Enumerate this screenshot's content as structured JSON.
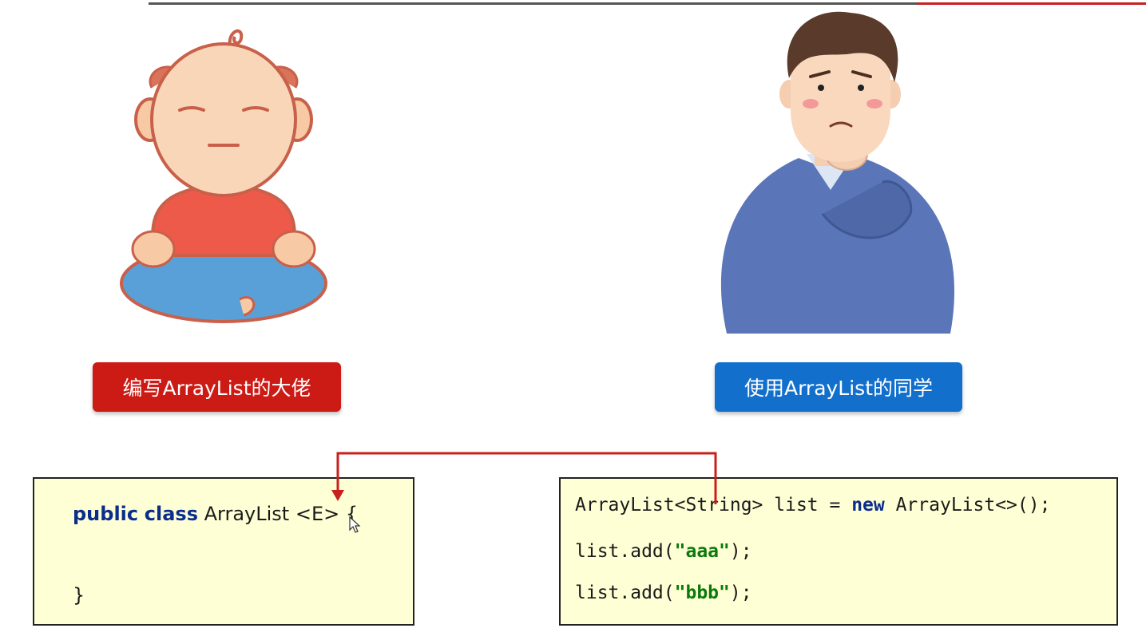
{
  "labels": {
    "left": "编写ArrayList的大佬",
    "right": "使用ArrayList的同学"
  },
  "code_left": {
    "line1_kw1": "public",
    "line1_kw2": "class",
    "line1_rest": " ArrayList <E> {",
    "line2": "}"
  },
  "code_right": {
    "line1_a": "ArrayList<String> list = ",
    "line1_kw": "new",
    "line1_b": " ArrayList<>();",
    "line2_a": "list.add(",
    "line2_str": "\"aaa\"",
    "line2_b": ");",
    "line3_a": "list.add(",
    "line3_str": "\"bbb\"",
    "line3_b": ");"
  },
  "colors": {
    "label_left_bg": "#cc1a14",
    "label_right_bg": "#1270cc",
    "arrow": "#c8201e",
    "code_bg": "#ffffd6"
  },
  "icons": {
    "left_figure": "meditating-developer-illustration",
    "right_figure": "thinking-student-illustration",
    "cursor": "mouse-cursor-icon"
  }
}
